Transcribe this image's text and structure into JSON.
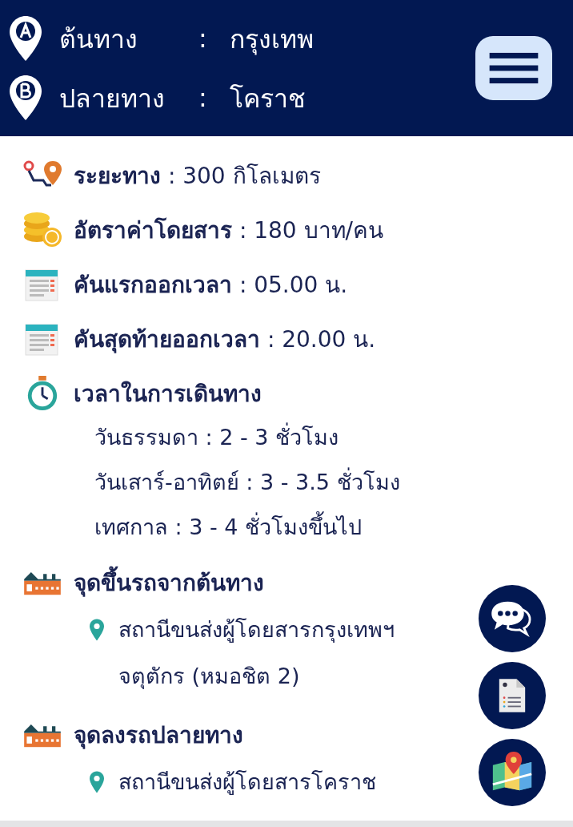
{
  "route": [
    {
      "kind": "origin",
      "label": "ต้นทาง",
      "separator": ":",
      "value": "กรุงเทพ"
    },
    {
      "kind": "destination",
      "label": "ปลายทาง",
      "separator": ":",
      "value": "โคราช"
    }
  ],
  "info": [
    {
      "kind": "distance",
      "label": "ระยะทาง",
      "value": " : 300 กิโลเมตร"
    },
    {
      "kind": "fare",
      "label": "อัตราค่าโดยสาร",
      "value": " : 180 บาท/คน"
    },
    {
      "kind": "calendar",
      "label": "คันแรกออกเวลา",
      "value": " : 05.00 น."
    },
    {
      "kind": "calendar",
      "label": "คันสุดท้ายออกเวลา",
      "value": " : 20.00 น."
    },
    {
      "kind": "duration",
      "label": "เวลาในการเดินทาง",
      "details": [
        "วันธรรมดา : 2 - 3 ชั่วโมง",
        "วันเสาร์-อาทิตย์ : 3 - 3.5 ชั่วโมง",
        "เทศกาล : 3 - 4 ชั่วโมงขึ้นไป"
      ]
    },
    {
      "kind": "station",
      "label": "จุดขึ้นรถจากต้นทาง",
      "stops": [
        [
          "สถานีขนส่งผู้โดยสารกรุงเทพฯ",
          "จตุตักร (หมอชิต 2)"
        ]
      ]
    },
    {
      "kind": "station",
      "label": "จุดลงรถปลายทาง",
      "stops": [
        [
          "สถานีขนส่งผู้โดยสารโคราช"
        ]
      ]
    }
  ],
  "actions": [
    {
      "kind": "chat"
    },
    {
      "kind": "document"
    },
    {
      "kind": "map"
    }
  ]
}
